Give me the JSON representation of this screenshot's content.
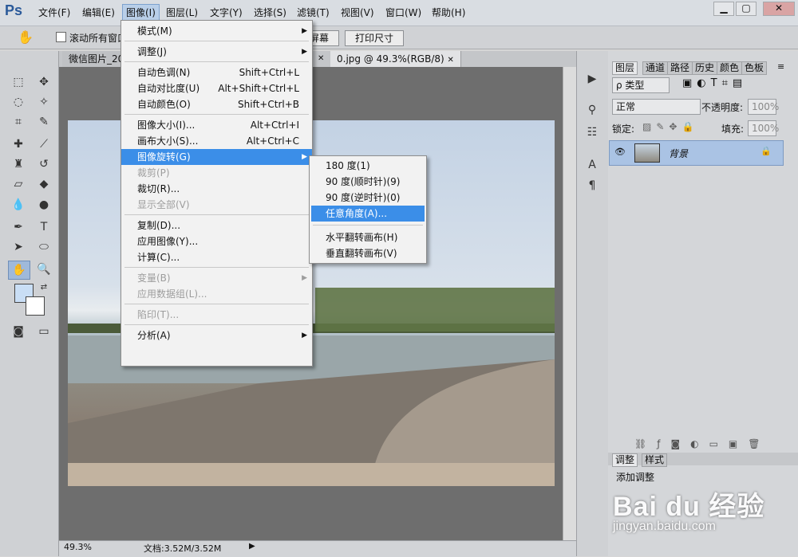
{
  "app": {
    "logo": "Ps"
  },
  "menubar": [
    "文件(F)",
    "编辑(E)",
    "图像(I)",
    "图层(L)",
    "文字(Y)",
    "选择(S)",
    "滤镜(T)",
    "视图(V)",
    "窗口(W)",
    "帮助(H)"
  ],
  "window_buttons": {
    "minimize": "▁",
    "maximize": "▢",
    "close": "✕"
  },
  "options": {
    "scroll_all": "滚动所有窗口",
    "fit_screen": "屏幕",
    "print_size": "打印尺寸"
  },
  "tabs": [
    {
      "label": "微信图片_20"
    },
    {
      "label": "0.jpg @ 49.3%(RGB/8)",
      "close": "✕"
    }
  ],
  "tab1_close": "✕",
  "image_menu": [
    {
      "label": "模式(M)",
      "submenu": true
    },
    {
      "sep": true
    },
    {
      "label": "调整(J)",
      "submenu": true
    },
    {
      "sep": true
    },
    {
      "label": "自动色调(N)",
      "shortcut": "Shift+Ctrl+L"
    },
    {
      "label": "自动对比度(U)",
      "shortcut": "Alt+Shift+Ctrl+L"
    },
    {
      "label": "自动颜色(O)",
      "shortcut": "Shift+Ctrl+B"
    },
    {
      "sep": true
    },
    {
      "label": "图像大小(I)...",
      "shortcut": "Alt+Ctrl+I"
    },
    {
      "label": "画布大小(S)...",
      "shortcut": "Alt+Ctrl+C"
    },
    {
      "label": "图像旋转(G)",
      "submenu": true,
      "highlight": true
    },
    {
      "label": "裁剪(P)",
      "disabled": true
    },
    {
      "label": "裁切(R)..."
    },
    {
      "label": "显示全部(V)",
      "disabled": true
    },
    {
      "sep": true
    },
    {
      "label": "复制(D)..."
    },
    {
      "label": "应用图像(Y)..."
    },
    {
      "label": "计算(C)..."
    },
    {
      "sep": true
    },
    {
      "label": "变量(B)",
      "submenu": true,
      "disabled": true
    },
    {
      "label": "应用数据组(L)...",
      "disabled": true
    },
    {
      "sep": true
    },
    {
      "label": "陷印(T)...",
      "disabled": true
    },
    {
      "sep": true
    },
    {
      "label": "分析(A)",
      "submenu": true
    }
  ],
  "rotate_menu": [
    {
      "label": "180 度(1)"
    },
    {
      "label": "90 度(顺时针)(9)"
    },
    {
      "label": "90 度(逆时针)(0)"
    },
    {
      "label": "任意角度(A)...",
      "highlight": true
    },
    {
      "sep": true
    },
    {
      "label": "水平翻转画布(H)"
    },
    {
      "label": "垂直翻转画布(V)"
    }
  ],
  "panel_tabs": [
    "图层",
    "通道",
    "路径",
    "历史",
    "颜色",
    "色板"
  ],
  "layers": {
    "filter": "ρ 类型",
    "blend": "正常",
    "opacity_label": "不透明度:",
    "opacity": "100%",
    "lock_label": "锁定:",
    "fill_label": "填充:",
    "fill": "100%",
    "layer_name": "背景"
  },
  "adjust_tabs": [
    "调整",
    "样式"
  ],
  "adjust_title": "添加调整",
  "status": {
    "zoom": "49.3%",
    "doc": "文档:3.52M/3.52M"
  },
  "watermark": {
    "brand": "Bai du 经验",
    "url": "jingyan.baidu.com"
  }
}
